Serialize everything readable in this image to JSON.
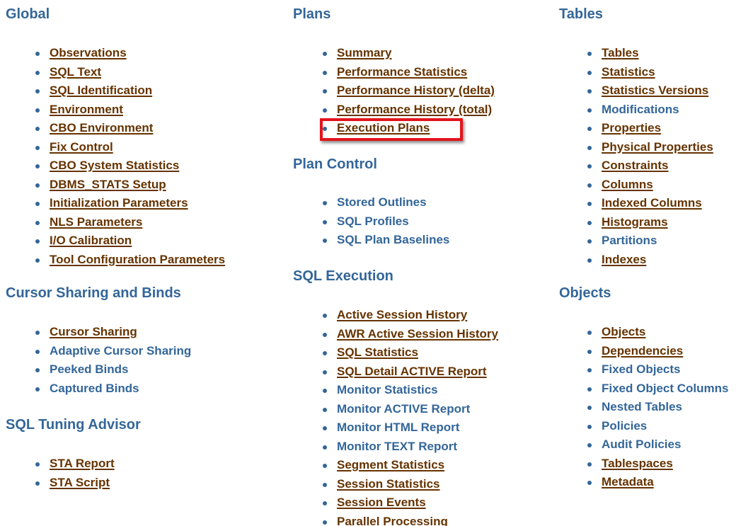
{
  "highlight_color": "#e3141b",
  "link_color": "#663300",
  "heading_color": "#336699",
  "sections": {
    "global": {
      "title": "Global",
      "items": [
        {
          "label": "Observations",
          "underlined": true
        },
        {
          "label": "SQL Text",
          "underlined": true
        },
        {
          "label": "SQL Identification",
          "underlined": true
        },
        {
          "label": "Environment",
          "underlined": true
        },
        {
          "label": "CBO Environment",
          "underlined": true
        },
        {
          "label": "Fix Control",
          "underlined": true
        },
        {
          "label": "CBO System Statistics",
          "underlined": true
        },
        {
          "label": "DBMS_STATS Setup",
          "underlined": true
        },
        {
          "label": "Initialization Parameters",
          "underlined": true
        },
        {
          "label": "NLS Parameters",
          "underlined": true
        },
        {
          "label": "I/O Calibration",
          "underlined": true
        },
        {
          "label": "Tool Configuration Parameters",
          "underlined": true
        }
      ]
    },
    "cursor_sharing": {
      "title": "Cursor Sharing and Binds",
      "items": [
        {
          "label": "Cursor Sharing",
          "underlined": true
        },
        {
          "label": "Adaptive Cursor Sharing",
          "underlined": false
        },
        {
          "label": "Peeked Binds",
          "underlined": false
        },
        {
          "label": "Captured Binds",
          "underlined": false
        }
      ]
    },
    "sql_tuning_advisor": {
      "title": "SQL Tuning Advisor",
      "items": [
        {
          "label": "STA Report",
          "underlined": true
        },
        {
          "label": "STA Script",
          "underlined": true
        }
      ]
    },
    "plans": {
      "title": "Plans",
      "items": [
        {
          "label": "Summary",
          "underlined": true
        },
        {
          "label": "Performance Statistics",
          "underlined": true
        },
        {
          "label": "Performance History (delta)",
          "underlined": true
        },
        {
          "label": "Performance History (total)",
          "underlined": true
        },
        {
          "label": "Execution Plans",
          "underlined": true,
          "highlighted": true
        }
      ]
    },
    "plan_control": {
      "title": "Plan Control",
      "items": [
        {
          "label": "Stored Outlines",
          "underlined": false
        },
        {
          "label": "SQL Profiles",
          "underlined": false
        },
        {
          "label": "SQL Plan Baselines",
          "underlined": false
        }
      ]
    },
    "sql_execution": {
      "title": "SQL Execution",
      "items": [
        {
          "label": "Active Session History",
          "underlined": true
        },
        {
          "label": "AWR Active Session History",
          "underlined": true
        },
        {
          "label": "SQL Statistics",
          "underlined": true
        },
        {
          "label": "SQL Detail ACTIVE Report",
          "underlined": true
        },
        {
          "label": "Monitor Statistics",
          "underlined": false
        },
        {
          "label": "Monitor ACTIVE Report",
          "underlined": false
        },
        {
          "label": "Monitor HTML Report",
          "underlined": false
        },
        {
          "label": "Monitor TEXT Report",
          "underlined": false
        },
        {
          "label": "Segment Statistics",
          "underlined": true
        },
        {
          "label": "Session Statistics",
          "underlined": true
        },
        {
          "label": "Session Events",
          "underlined": true
        },
        {
          "label": "Parallel Processing",
          "underlined": true
        }
      ]
    },
    "tables": {
      "title": "Tables",
      "items": [
        {
          "label": "Tables",
          "underlined": true
        },
        {
          "label": "Statistics",
          "underlined": true
        },
        {
          "label": "Statistics Versions",
          "underlined": true
        },
        {
          "label": "Modifications",
          "underlined": false
        },
        {
          "label": "Properties",
          "underlined": true
        },
        {
          "label": "Physical Properties",
          "underlined": true
        },
        {
          "label": "Constraints",
          "underlined": true
        },
        {
          "label": "Columns",
          "underlined": true
        },
        {
          "label": "Indexed Columns",
          "underlined": true
        },
        {
          "label": "Histograms",
          "underlined": true
        },
        {
          "label": "Partitions",
          "underlined": false
        },
        {
          "label": "Indexes",
          "underlined": true
        }
      ]
    },
    "objects": {
      "title": "Objects",
      "items": [
        {
          "label": "Objects",
          "underlined": true
        },
        {
          "label": "Dependencies",
          "underlined": true
        },
        {
          "label": "Fixed Objects",
          "underlined": false
        },
        {
          "label": "Fixed Object Columns",
          "underlined": false
        },
        {
          "label": "Nested Tables",
          "underlined": false
        },
        {
          "label": "Policies",
          "underlined": false
        },
        {
          "label": "Audit Policies",
          "underlined": false
        },
        {
          "label": "Tablespaces",
          "underlined": true
        },
        {
          "label": "Metadata",
          "underlined": true
        }
      ]
    }
  }
}
